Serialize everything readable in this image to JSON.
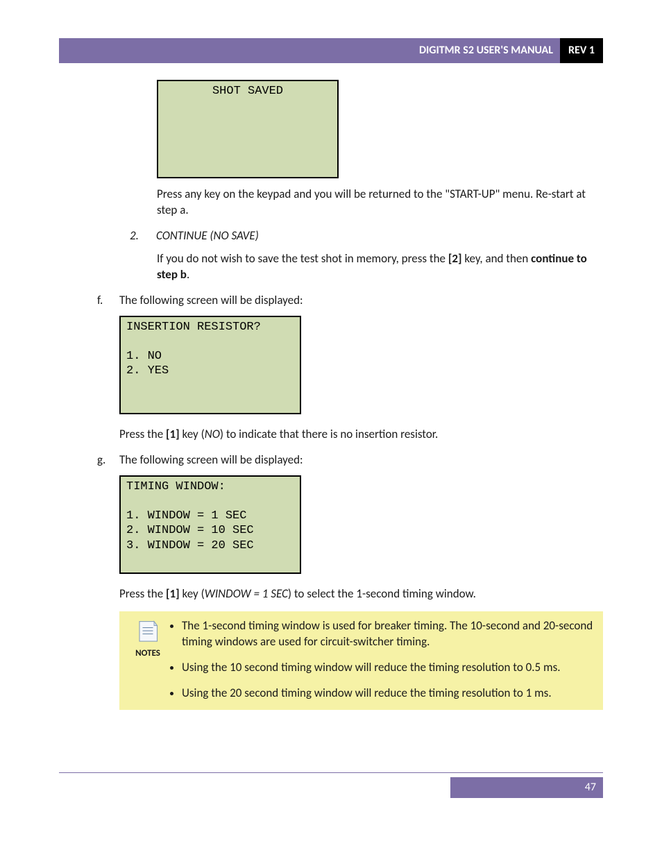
{
  "header": {
    "title": "DIGITMR S2 USER'S MANUAL",
    "rev": "REV 1"
  },
  "lcd_shot": "SHOT SAVED",
  "para_press_any": "Press any key on the keypad and you will be returned to the \"START-UP\" menu. Re-start at step a.",
  "step2": {
    "num": "2.",
    "label": "CONTINUE (NO SAVE)"
  },
  "para_nosave_a": "If you do not wish to save the test shot in memory, press the ",
  "key2": "[2]",
  "para_nosave_b": " key, and then ",
  "para_nosave_c": "continue to step b",
  "para_nosave_d": ".",
  "step_f": {
    "num": "f.",
    "label": "The following screen will be displayed:"
  },
  "lcd_ins": "INSERTION RESISTOR?\n\n1. NO\n2. YES",
  "para_f_a": "Press the ",
  "key1a": "[1]",
  "para_f_b": " key (",
  "para_f_no": "NO",
  "para_f_c": ") to indicate that there is no insertion resistor.",
  "step_g": {
    "num": "g.",
    "label": "The following screen will be displayed:"
  },
  "lcd_tim": "TIMING WINDOW:\n\n1. WINDOW = 1 SEC\n2. WINDOW = 10 SEC\n3. WINDOW = 20 SEC",
  "para_g_a": "Press the ",
  "key1b": "[1]",
  "para_g_b": " key (",
  "para_g_win": "WINDOW = 1 SEC",
  "para_g_c": ") to select the 1-second timing window.",
  "notes_label": "NOTES",
  "notes": [
    "The 1-second timing window is used for breaker timing. The 10-second and 20-second timing windows are used for circuit-switcher timing.",
    "Using the 10 second timing window will reduce the timing resolution to 0.5 ms.",
    "Using the 20 second timing window will reduce the timing resolution to 1 ms."
  ],
  "page_number": "47"
}
